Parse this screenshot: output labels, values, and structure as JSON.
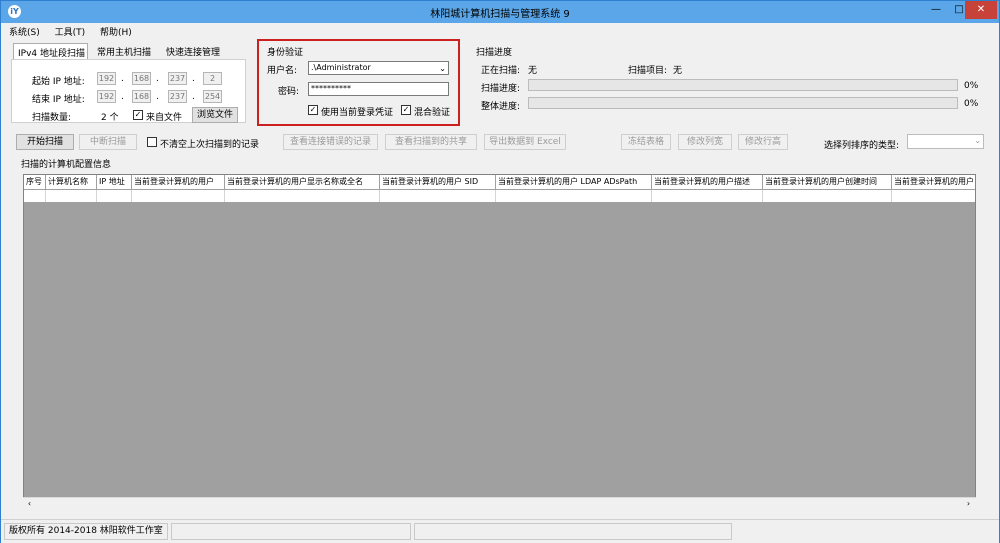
{
  "window": {
    "title": "林阳城计算机扫描与管理系统 9",
    "app_icon": "iY",
    "minimize": "—",
    "maximize": "□",
    "close": "✕"
  },
  "menu": [
    "系统(S)",
    "工具(T)",
    "帮助(H)"
  ],
  "tabs": [
    "IPv4 地址段扫描",
    "常用主机扫描",
    "快速连接管理"
  ],
  "ipv4_panel": {
    "start_label": "起始 IP 地址:",
    "end_label": "结束 IP 地址:",
    "start_ip": [
      "192",
      "168",
      "237",
      "2"
    ],
    "end_ip": [
      "192",
      "168",
      "237",
      "254"
    ],
    "count_label": "扫描数量:",
    "count_value": "2 个",
    "from_file_label": "来自文件",
    "from_file_checked": true,
    "browse_label": "浏览文件"
  },
  "auth": {
    "group_title": "身份验证",
    "username_label": "用户名:",
    "username_value": ".\\Administrator",
    "password_label": "密码:",
    "password_value": "**********",
    "use_current_label": "使用当前登录凭证",
    "use_current_checked": true,
    "mixed_label": "混合验证",
    "mixed_checked": true
  },
  "progress": {
    "group_title": "扫描进度",
    "scanning_label": "正在扫描:",
    "scanning_value": "无",
    "item_label": "扫描项目:",
    "item_value": "无",
    "scan_progress_label": "扫描进度:",
    "scan_progress_pct": "0%",
    "overall_label": "整体进度:",
    "overall_pct": "0%",
    "scan_progress_fraction": 0,
    "overall_fraction": 0
  },
  "toolbar": {
    "start_scan": "开始扫描",
    "stop_scan": "中断扫描",
    "no_clear_label": "不清空上次扫描到的记录",
    "no_clear_checked": false,
    "view_errors": "查看连接错误的记录",
    "view_shares": "查看扫描到的共享",
    "export_excel": "导出数据到 Excel",
    "freeze_table": "冻结表格",
    "col_width": "修改列宽",
    "row_height": "修改行高",
    "sort_label": "选择列排序的类型:",
    "sort_value": ""
  },
  "table": {
    "section_title": "扫描的计算机配置信息",
    "columns": [
      "序号",
      "计算机名称",
      "IP 地址",
      "当前登录计算机的用户",
      "当前登录计算机的用户显示名称或全名",
      "当前登录计算机的用户 SID",
      "当前登录计算机的用户 LDAP ADsPath",
      "当前登录计算机的用户描述",
      "当前登录计算机的用户创建时间",
      "当前登录计算机的用户"
    ]
  },
  "statusbar": {
    "copyright": "版权所有 2014-2018 林阳软件工作室"
  },
  "colors": {
    "titlebar": "#5aa6e8",
    "close": "#c7433a",
    "highlight_border": "#cc2020"
  }
}
